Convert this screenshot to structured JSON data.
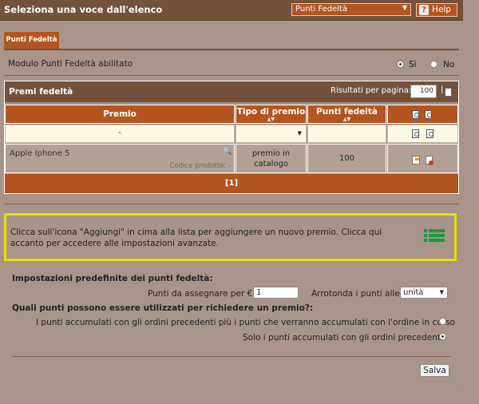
{
  "header": {
    "title": "Seleziona una voce dall'elenco",
    "selected_option": "Punti Fedeltà",
    "help_label": "Help",
    "help_glyph": "?"
  },
  "tab": {
    "label": "Punti Fedeltà"
  },
  "module": {
    "label": "Modulo Punti Fedeltà abilitato",
    "options": [
      "Sì",
      "No"
    ],
    "selected": "Sì"
  },
  "table": {
    "title": "Premi fedeltà",
    "results_per_page_label": "Risultati per pagina:",
    "results_per_page_value": "100",
    "pipe": "|",
    "columns": [
      "Premio",
      "Tipo di premio",
      "Punti fedeltà"
    ],
    "filter": {
      "premio": "-"
    },
    "rows": [
      {
        "name": "Apple Iphone 5",
        "code_label": "Codice prodotto: -",
        "type": "premio in catalogo",
        "points": "100"
      }
    ],
    "pager": "[1]"
  },
  "info": {
    "text": "Clicca sull'icona \"Aggiungi\" in cima alla lista per aggiungere un nuovo premio. Clicca qui accanto per accedere alle impostazioni avanzate."
  },
  "settings": {
    "heading": "Impostazioni predefinite dei punti fedeltà:",
    "points_per_euro_label": "Punti da assegnare per €:",
    "points_per_euro_value": "1",
    "round_label": "Arrotonda i punti alle:",
    "round_value": "unità",
    "question": "Quali punti possono essere utilizzati per richiedere un premio?:",
    "option_1": "I punti accumulati con gli ordini precedenti più i punti che verranno accumulati con l'ordine in corso",
    "option_2": "Solo i punti accumulati con gli ordini precedenti",
    "selected_option": 2,
    "save_label": "Salva"
  },
  "colors": {
    "header_bg": "#74513b",
    "accent": "#b4551f",
    "background": "#a8948a",
    "highlight_border": "#e8e000",
    "icon_green": "#1a9a3a"
  },
  "icons": [
    "help-icon",
    "table-options-icon",
    "copy-icon",
    "search-icon",
    "edit-icon",
    "delete-icon",
    "list-icon",
    "dropdown-caret-icon",
    "sort-arrows-icon"
  ]
}
